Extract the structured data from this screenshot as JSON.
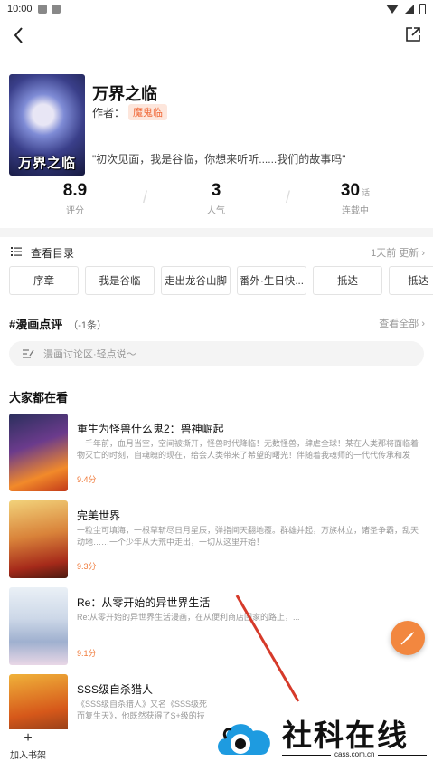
{
  "status_bar": {
    "time": "10:00"
  },
  "manga": {
    "title": "万界之临",
    "author_label": "作者：",
    "author": "魔鬼临",
    "cover_text": "万界之临",
    "tagline": "\"初次见面，我是谷临，你想来听听......我们的故事吗\""
  },
  "stats": [
    {
      "value": "8.9",
      "unit": "",
      "label": "评分"
    },
    {
      "value": "3",
      "unit": "",
      "label": "人气"
    },
    {
      "value": "30",
      "unit": "话",
      "label": "连载中"
    }
  ],
  "toc": {
    "label": "查看目录",
    "update": "1天前 更新 ›",
    "chapters": [
      "序章",
      "我是谷临",
      "走出龙谷山脚",
      "番外·生日快...",
      "抵达",
      "抵达（"
    ]
  },
  "reviews": {
    "title": "#漫画点评",
    "count": "（-1条）",
    "view_all": "查看全部 ›",
    "placeholder": "漫画讨论区·轻点说～"
  },
  "recommend": {
    "section_title": "大家都在看",
    "items": [
      {
        "title": "重生为怪兽什么鬼2：兽神崛起",
        "desc": "一千年前，血月当空，空间被撕开，怪兽时代降临！无数怪兽，肆虐全球！某在人类那将面临着物灭亡的时刻，自魂魄的现在，给会人类带来了希望的曙光！伴随着我魂师的一代代传承和发展，人类成功创造出...",
        "score": "9.4分"
      },
      {
        "title": "完美世界",
        "desc": "一粒尘可填海，一根草斩尽日月星辰，弹指间天翻地覆。群雄并起，万族林立，诸圣争霸，乱天动地……一个少年从大荒中走出，一切从这里开始！",
        "score": "9.3分"
      },
      {
        "title": "Re：从零开始的异世界生活",
        "desc": "Re:从零开始的异世界生活漫画，在从便利商店回家的路上，...",
        "score": "9.1分"
      },
      {
        "title": "SSS级自杀猎人",
        "desc": "《SSS级自杀猎人》又名《SSS级死而复生天》，他既然获得了S+级的技能，但开心的...",
        "score": ""
      }
    ]
  },
  "bottom_bar": {
    "add_shelf": "加入书架"
  },
  "watermark": {
    "name": "社科在线",
    "url": "cass.com.cn"
  }
}
